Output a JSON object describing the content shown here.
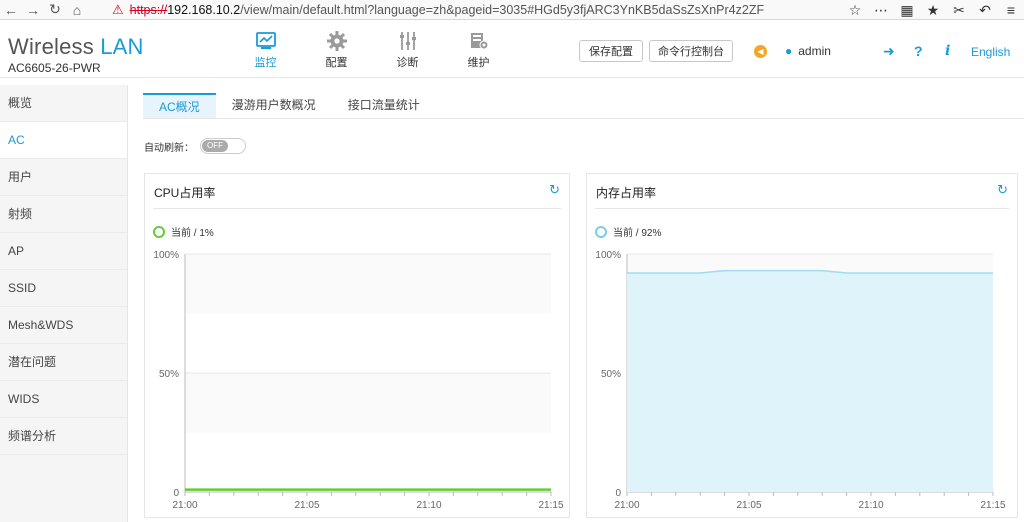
{
  "browser": {
    "url_protocol": "https://",
    "url_host": "192.168.10.2",
    "url_path": "/view/main/default.html?language=zh&pageid=3035#HGd5y3fjARC3YnKB5daSsZsXnPr4z2ZF",
    "icons": [
      "back-icon",
      "forward-icon",
      "reload-icon",
      "home-icon",
      "shield-icon",
      "star-icon",
      "more-icon",
      "grid-icon",
      "bookmarks-icon",
      "scissors-icon",
      "undo-icon",
      "menu-icon"
    ]
  },
  "header": {
    "brand_prefix": "Wireless",
    "brand_suffix": "LAN",
    "model": "AC6605-26-PWR",
    "nav": [
      {
        "label": "监控",
        "icon": "monitor-icon"
      },
      {
        "label": "配置",
        "icon": "gear-icon"
      },
      {
        "label": "诊断",
        "icon": "sliders-icon"
      },
      {
        "label": "维护",
        "icon": "maintenance-icon"
      }
    ],
    "save_label": "保存配置",
    "console_label": "命令行控制台",
    "user": "admin",
    "language": "English"
  },
  "sidebar": {
    "items": [
      "概览",
      "AC",
      "用户",
      "射频",
      "AP",
      "SSID",
      "Mesh&WDS",
      "潜在问题",
      "WIDS",
      "频谱分析"
    ],
    "active_index": 1
  },
  "tabs": [
    "AC概况",
    "漫游用户数概况",
    "接口流量统计"
  ],
  "auto_refresh": {
    "label": "自动刷新：",
    "state": "OFF"
  },
  "colors": {
    "accent": "#1a9bd7",
    "cpu_line": "#66cc33",
    "mem_line": "#9fdcef",
    "mem_fill": "#dff3fb"
  },
  "cpu_panel": {
    "title": "CPU占用率",
    "legend": "当前 / 1%"
  },
  "mem_panel": {
    "title": "内存占用率",
    "legend": "当前 / 92%"
  },
  "chart_data": [
    {
      "type": "line",
      "title": "CPU占用率",
      "x": [
        "21:00",
        "21:01",
        "21:02",
        "21:03",
        "21:04",
        "21:05",
        "21:06",
        "21:07",
        "21:08",
        "21:09",
        "21:10",
        "21:11",
        "21:12",
        "21:13",
        "21:14",
        "21:15"
      ],
      "xticks": [
        "21:00",
        "21:05",
        "21:10",
        "21:15"
      ],
      "series": [
        {
          "name": "当前",
          "values": [
            1,
            1,
            1,
            1,
            1,
            1,
            1,
            1,
            1,
            1,
            1,
            1,
            1,
            1,
            1,
            1
          ]
        }
      ],
      "yticks": [
        "0",
        "50%",
        "100%"
      ],
      "ylim": [
        0,
        100
      ]
    },
    {
      "type": "area",
      "title": "内存占用率",
      "x": [
        "21:00",
        "21:01",
        "21:02",
        "21:03",
        "21:04",
        "21:05",
        "21:06",
        "21:07",
        "21:08",
        "21:09",
        "21:10",
        "21:11",
        "21:12",
        "21:13",
        "21:14",
        "21:15"
      ],
      "xticks": [
        "21:00",
        "21:05",
        "21:10",
        "21:15"
      ],
      "series": [
        {
          "name": "当前",
          "values": [
            92,
            92,
            92,
            92,
            93,
            93,
            93,
            93,
            93,
            92,
            92,
            92,
            92,
            92,
            92,
            92
          ]
        }
      ],
      "yticks": [
        "0",
        "50%",
        "100%"
      ],
      "ylim": [
        0,
        100
      ]
    }
  ]
}
